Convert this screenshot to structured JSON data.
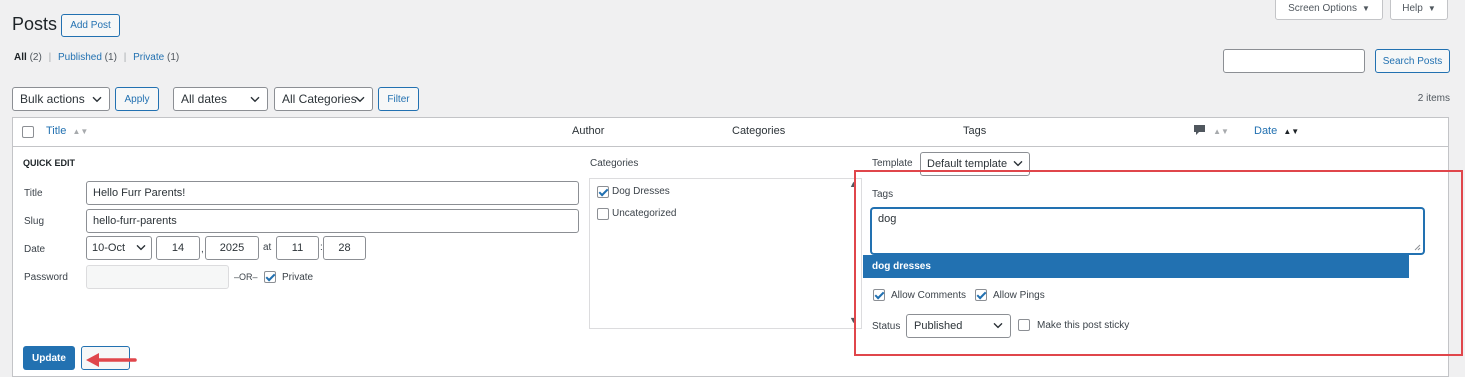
{
  "header": {
    "title": "Posts",
    "add_post": "Add Post",
    "screen_options": "Screen Options",
    "help": "Help"
  },
  "filters": {
    "all_label": "All",
    "all_count": "(2)",
    "published_label": "Published",
    "published_count": "(1)",
    "private_label": "Private",
    "private_count": "(1)",
    "separator": "|"
  },
  "search": {
    "value": "",
    "button": "Search Posts"
  },
  "tablenav": {
    "bulk_actions": "Bulk actions",
    "apply": "Apply",
    "dates": "All dates",
    "categories": "All Categories",
    "filter": "Filter",
    "count": "2 items"
  },
  "columns": {
    "title": "Title",
    "author": "Author",
    "categories": "Categories",
    "tags": "Tags",
    "date": "Date"
  },
  "quick_edit": {
    "heading": "QUICK EDIT",
    "title_label": "Title",
    "title_value": "Hello Furr Parents!",
    "slug_label": "Slug",
    "slug_value": "hello-furr-parents",
    "date_label": "Date",
    "month": "10-Oct",
    "day": "14",
    "year": "2025",
    "at": "at",
    "hour": "11",
    "minute": "28",
    "colon": ":",
    "comma": ",",
    "password_label": "Password",
    "password_value": "",
    "or": "–OR–",
    "private_label": "Private",
    "private_checked": true,
    "categories_label": "Categories",
    "categories": [
      {
        "label": "Dog Dresses",
        "checked": true
      },
      {
        "label": "Uncategorized",
        "checked": false
      }
    ],
    "template_label": "Template",
    "template_value": "Default template",
    "tags_label": "Tags",
    "tags_value": "dog",
    "suggestion": "dog dresses",
    "allow_comments": "Allow Comments",
    "allow_pings": "Allow Pings",
    "status_label": "Status",
    "status_value": "Published",
    "sticky_label": "Make this post sticky",
    "update": "Update"
  },
  "colors": {
    "accent": "#2271b1",
    "highlight_box": "#e0464b",
    "suggestion_bg": "#2271b1"
  }
}
